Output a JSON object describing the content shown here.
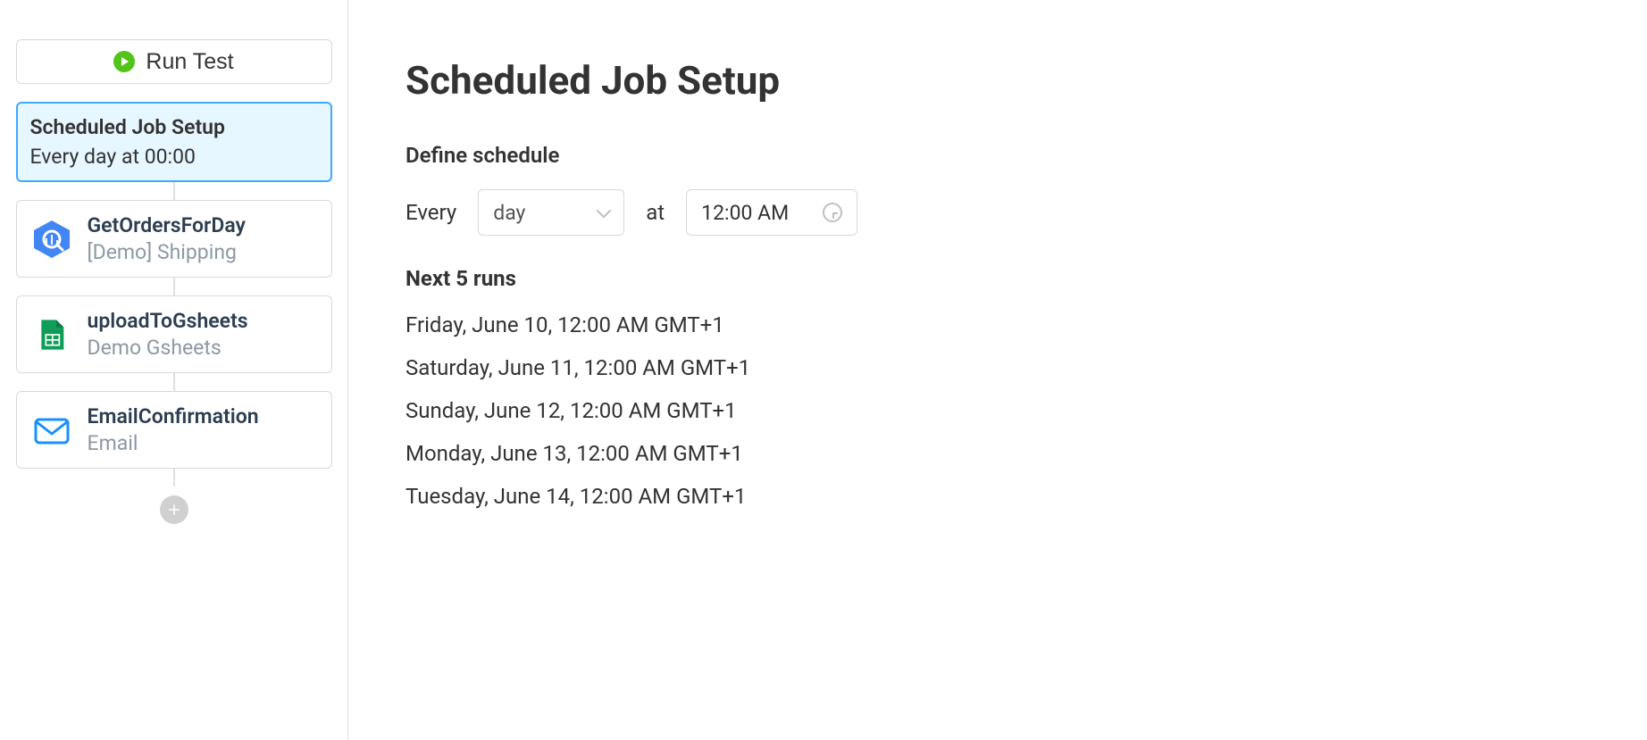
{
  "sidebar": {
    "run_label": "Run Test",
    "schedule": {
      "title": "Scheduled Job Setup",
      "sub": "Every day at 00:00"
    },
    "steps": [
      {
        "title": "GetOrdersForDay",
        "sub": "[Demo] Shipping",
        "icon": "bigquery-icon"
      },
      {
        "title": "uploadToGsheets",
        "sub": "Demo Gsheets",
        "icon": "gsheets-icon"
      },
      {
        "title": "EmailConfirmation",
        "sub": "Email",
        "icon": "email-icon"
      }
    ]
  },
  "main": {
    "title": "Scheduled Job Setup",
    "define_label": "Define schedule",
    "every_label": "Every",
    "unit_value": "day",
    "at_label": "at",
    "time_value": "12:00 AM",
    "next_label": "Next 5 runs",
    "runs": [
      "Friday, June 10, 12:00 AM GMT+1",
      "Saturday, June 11, 12:00 AM GMT+1",
      "Sunday, June 12, 12:00 AM GMT+1",
      "Monday, June 13, 12:00 AM GMT+1",
      "Tuesday, June 14, 12:00 AM GMT+1"
    ]
  }
}
